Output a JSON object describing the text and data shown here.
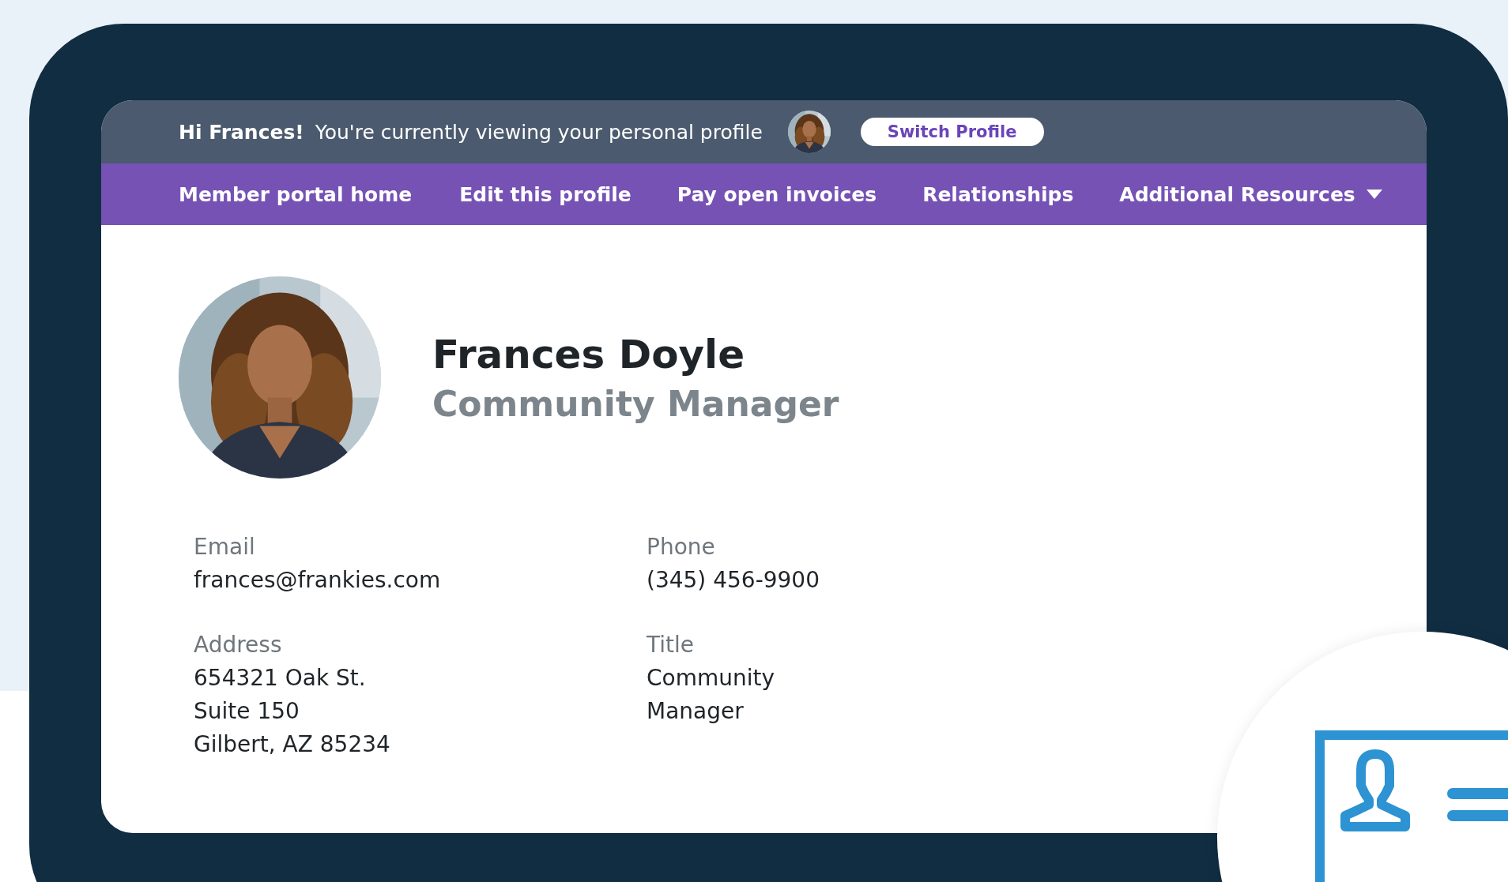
{
  "top_bar": {
    "greeting": "Hi Frances!",
    "message": "You're currently viewing your personal profile",
    "switch_button": "Switch Profile"
  },
  "nav": [
    {
      "label": "Member portal home",
      "kind": "link"
    },
    {
      "label": "Edit this profile",
      "kind": "link"
    },
    {
      "label": "Pay open invoices",
      "kind": "link"
    },
    {
      "label": "Relationships",
      "kind": "link"
    },
    {
      "label": "Additional Resources",
      "kind": "dropdown"
    }
  ],
  "profile": {
    "name": "Frances Doyle",
    "role": "Community Manager"
  },
  "fields": [
    {
      "label": "Email",
      "lines": [
        "frances@frankies.com"
      ]
    },
    {
      "label": "Phone",
      "lines": [
        "(345) 456-9900"
      ]
    },
    {
      "label": "Address",
      "lines": [
        "654321 Oak St.",
        "Suite 150",
        "Gilbert, AZ 85234"
      ]
    },
    {
      "label": "Title",
      "lines": [
        "Community",
        "Manager"
      ]
    }
  ]
}
